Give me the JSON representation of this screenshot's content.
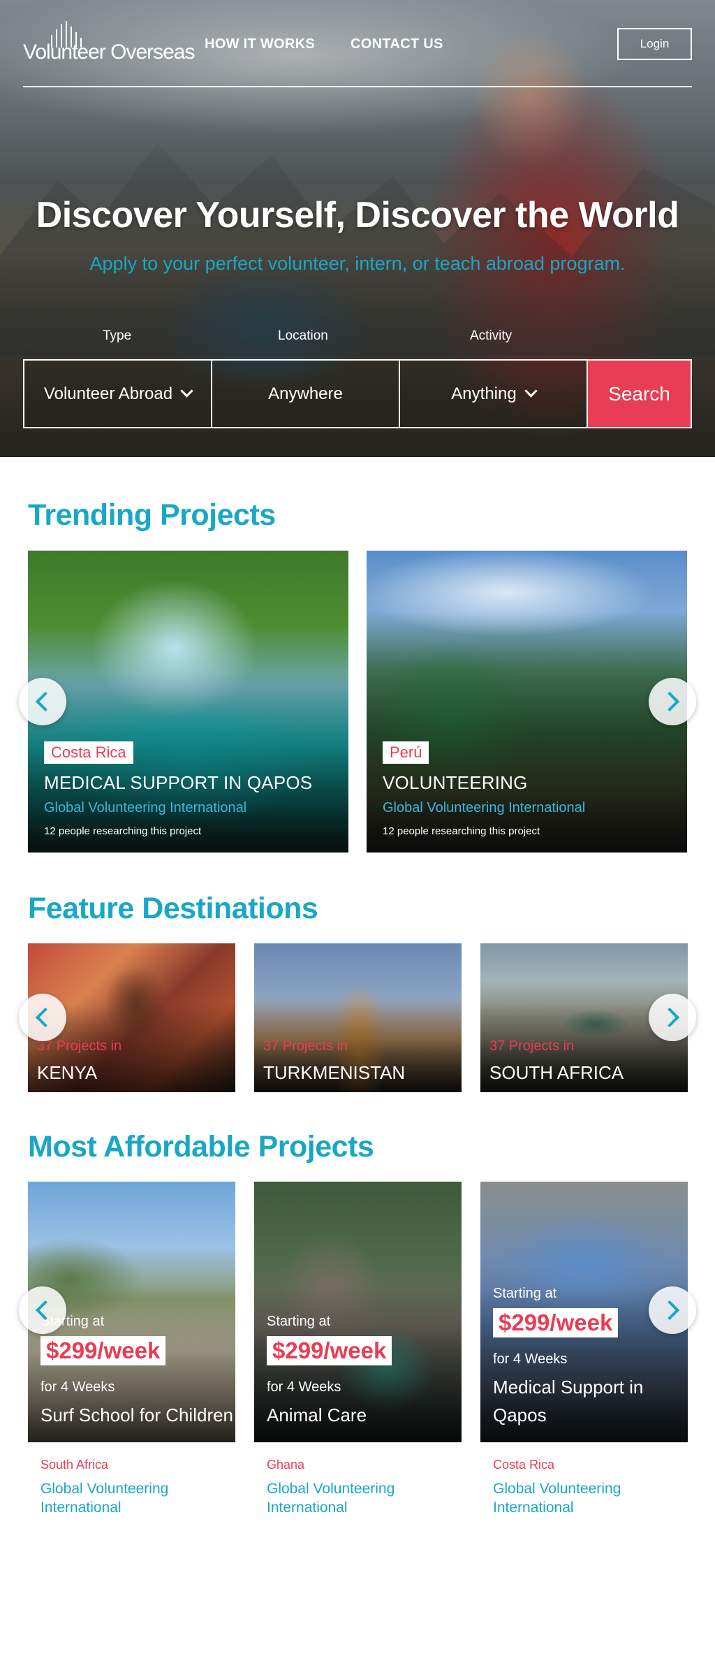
{
  "nav": {
    "logo_text": "Volunteer Overseas",
    "how_it_works": "HOW IT WORKS",
    "contact_us": "CONTACT US",
    "login": "Login"
  },
  "hero": {
    "title": "Discover Yourself, Discover the World",
    "subtitle": "Apply to your perfect volunteer, intern, or teach abroad program."
  },
  "search": {
    "type_label": "Type",
    "location_label": "Location",
    "activity_label": "Activity",
    "type_value": "Volunteer Abroad",
    "location_value": "Anywhere",
    "activity_value": "Anything",
    "button": "Search"
  },
  "trending": {
    "title": "Trending Projects",
    "items": [
      {
        "country": "Costa Rica",
        "title": "MEDICAL SUPPORT IN QAPOS",
        "org": "Global Volunteering International",
        "meta": "12 people researching this project"
      },
      {
        "country": "Perú",
        "title": "VOLUNTEERING",
        "org": "Global Volunteering International",
        "meta": "12 people researching this project"
      }
    ]
  },
  "destinations": {
    "title": "Feature Destinations",
    "items": [
      {
        "count": "37 Projects in",
        "name": "KENYA"
      },
      {
        "count": "37 Projects in",
        "name": "TURKMENISTAN"
      },
      {
        "count": "37 Projects in",
        "name": "SOUTH AFRICA"
      }
    ]
  },
  "affordable": {
    "title": "Most Affordable Projects",
    "items": [
      {
        "starting": "Starting at",
        "price": "$299/week",
        "duration": "for 4 Weeks",
        "title": "Surf School for Children",
        "country": "South Africa",
        "org": "Global Volunteering International"
      },
      {
        "starting": "Starting at",
        "price": "$299/week",
        "duration": "for 4 Weeks",
        "title": "Animal Care",
        "country": "Ghana",
        "org": "Global Volunteering International"
      },
      {
        "starting": "Starting at",
        "price": "$299/week",
        "duration": "for 4 Weeks",
        "title": "Medical Support in Qapos",
        "country": "Costa Rica",
        "org": "Global Volunteering International"
      }
    ]
  },
  "colors": {
    "accent_teal": "#19a7c6",
    "accent_red": "#e83d54"
  },
  "icons": {
    "carousel_prev": "chevron-left-icon",
    "carousel_next": "chevron-right-icon",
    "dropdown": "chevron-down-icon"
  }
}
